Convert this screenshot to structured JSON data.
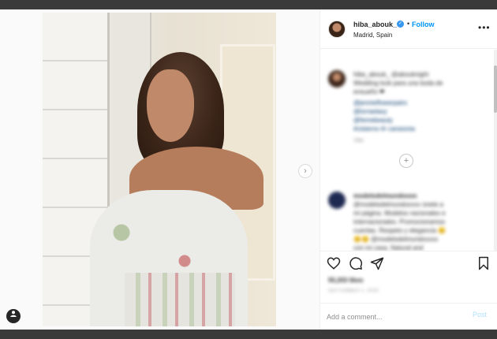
{
  "post": {
    "user": {
      "username": "hiba_abouk_",
      "verified": true,
      "follow_label": "Follow",
      "location": "Madrid, Spain"
    },
    "more_label": "•••",
    "caption": {
      "lines": [
        "hiba_abouk_ @abouknight",
        "Wedding look para una boda de",
        "ensueño ❤",
        "@jennieflowerpairs",
        "@lorraelaxy",
        "@femebeauty",
        "#cisterno #r cansionia"
      ],
      "time": "19w"
    },
    "comment": {
      "lines": [
        "modelsdelmundooox",
        "@modelsdelmundoxxxx únete a",
        "mi página. Modelos nacionales e",
        "internacionales. Promocionamos",
        "cuentas. Respeto y elegancia 😊",
        "😊😊 @modelsdelmundoxxxx",
        "con mi casa. Natural and"
      ]
    },
    "likes_text": "55,203 likes",
    "date_text": "SEPTEMBER 1, 2019",
    "add_comment_placeholder": "Add a comment...",
    "post_label": "Post",
    "next_glyph": "›",
    "load_more_glyph": "+"
  },
  "icons": [
    "heart-icon",
    "comment-icon",
    "share-icon",
    "bookmark-icon",
    "user-tag-icon",
    "verified-icon"
  ],
  "colors": {
    "accent": "#0095f6",
    "text": "#262626",
    "muted": "#8e8e8e",
    "post_disabled": "#b2dffc"
  }
}
